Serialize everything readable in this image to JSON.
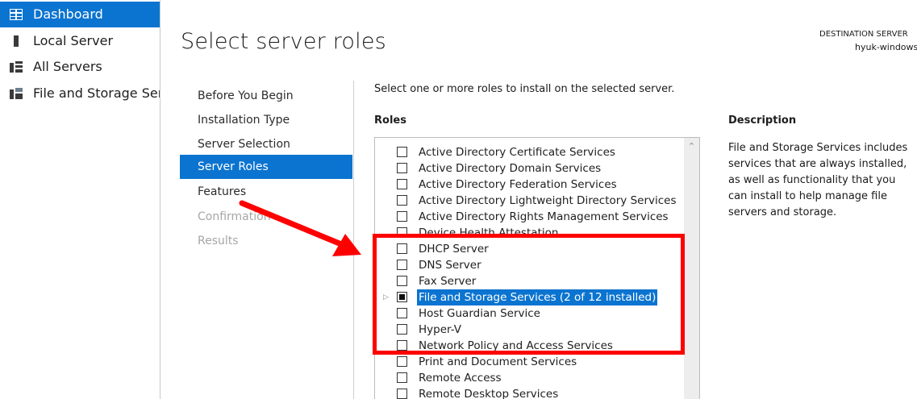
{
  "nav": {
    "items": [
      {
        "label": "Dashboard",
        "icon": "dashboard-icon",
        "active": true
      },
      {
        "label": "Local Server",
        "icon": "server-icon",
        "active": false
      },
      {
        "label": "All Servers",
        "icon": "servers-icon",
        "active": false
      },
      {
        "label": "File and Storage Services",
        "icon": "file-storage-icon",
        "active": false
      }
    ]
  },
  "header": {
    "title": "Select server roles",
    "destination_label": "DESTINATION SERVER",
    "destination_server": "hyuk-windows"
  },
  "steps": [
    {
      "label": "Before You Begin",
      "state": "normal"
    },
    {
      "label": "Installation Type",
      "state": "normal"
    },
    {
      "label": "Server Selection",
      "state": "normal"
    },
    {
      "label": "Server Roles",
      "state": "active"
    },
    {
      "label": "Features",
      "state": "normal"
    },
    {
      "label": "Confirmation",
      "state": "disabled"
    },
    {
      "label": "Results",
      "state": "disabled"
    }
  ],
  "main": {
    "instruction": "Select one or more roles to install on the selected server.",
    "roles_header": "Roles",
    "description_header": "Description",
    "description_text": "File and Storage Services includes services that are always installed, as well as functionality that you can install to help manage file servers and storage."
  },
  "roles": [
    {
      "label": "Active Directory Certificate Services",
      "state": "unchecked"
    },
    {
      "label": "Active Directory Domain Services",
      "state": "unchecked"
    },
    {
      "label": "Active Directory Federation Services",
      "state": "unchecked"
    },
    {
      "label": "Active Directory Lightweight Directory Services",
      "state": "unchecked"
    },
    {
      "label": "Active Directory Rights Management Services",
      "state": "unchecked"
    },
    {
      "label": "Device Health Attestation",
      "state": "unchecked"
    },
    {
      "label": "DHCP Server",
      "state": "unchecked"
    },
    {
      "label": "DNS Server",
      "state": "unchecked"
    },
    {
      "label": "Fax Server",
      "state": "unchecked"
    },
    {
      "label": "File and Storage Services (2 of 12 installed)",
      "state": "partial",
      "selected": true,
      "expandable": true
    },
    {
      "label": "Host Guardian Service",
      "state": "unchecked"
    },
    {
      "label": "Hyper-V",
      "state": "unchecked"
    },
    {
      "label": "Network Policy and Access Services",
      "state": "unchecked"
    },
    {
      "label": "Print and Document Services",
      "state": "unchecked"
    },
    {
      "label": "Remote Access",
      "state": "unchecked"
    },
    {
      "label": "Remote Desktop Services",
      "state": "unchecked"
    }
  ],
  "colors": {
    "accent": "#0b74d0",
    "annotation": "#ff0000"
  }
}
